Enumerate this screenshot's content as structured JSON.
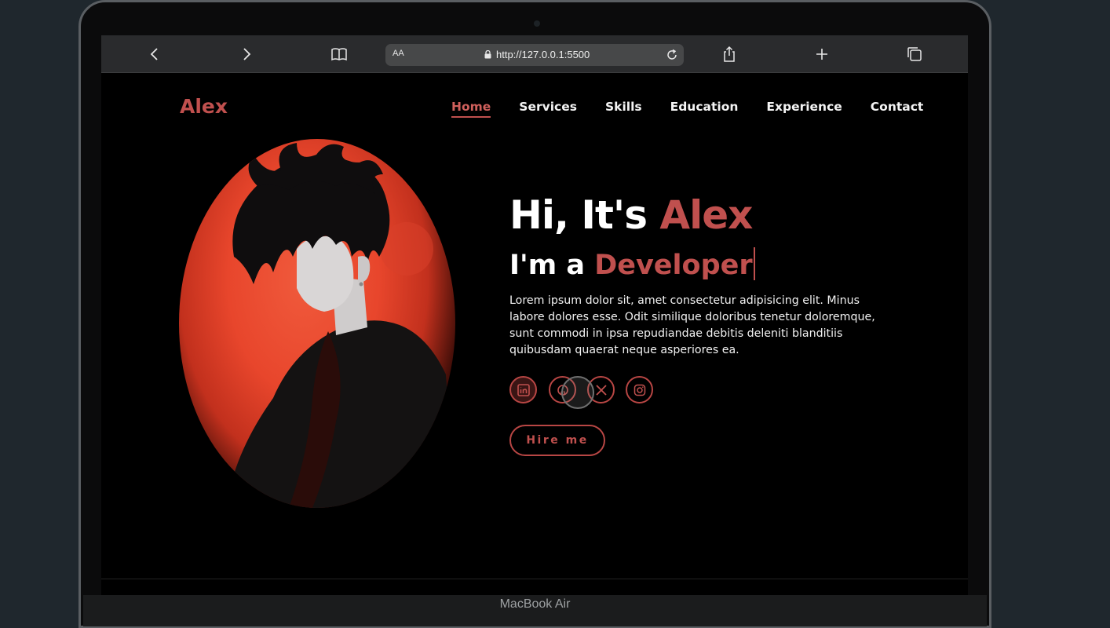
{
  "device": {
    "label": "MacBook Air"
  },
  "browser": {
    "aa_label": "AA",
    "url": "http://127.0.0.1:5500",
    "icons": [
      "chevron-left-icon",
      "chevron-right-icon",
      "book-icon",
      "lock-icon",
      "reload-icon",
      "share-icon",
      "plus-icon",
      "tabs-icon"
    ]
  },
  "site": {
    "logo": "Alex",
    "nav": [
      {
        "label": "Home",
        "active": true
      },
      {
        "label": "Services"
      },
      {
        "label": "Skills"
      },
      {
        "label": "Education"
      },
      {
        "label": "Experience"
      },
      {
        "label": "Contact"
      }
    ],
    "hero": {
      "greeting": "Hi, It's ",
      "name": "Alex",
      "role_prefix": "I'm a ",
      "role": "Developer",
      "description": "Lorem ipsum dolor sit, amet consectetur adipisicing elit. Minus labore dolores esse. Odit similique doloribus tenetur doloremque, sunt commodi in ipsa repudiandae debitis deleniti blanditiis quibusdam quaerat neque asperiores ea.",
      "socials": [
        "linkedin-icon",
        "github-icon",
        "x-icon",
        "instagram-icon"
      ],
      "cta": "Hire me"
    },
    "colors": {
      "accent": "#c0504e",
      "background": "#000000",
      "text": "#ffffff"
    }
  }
}
